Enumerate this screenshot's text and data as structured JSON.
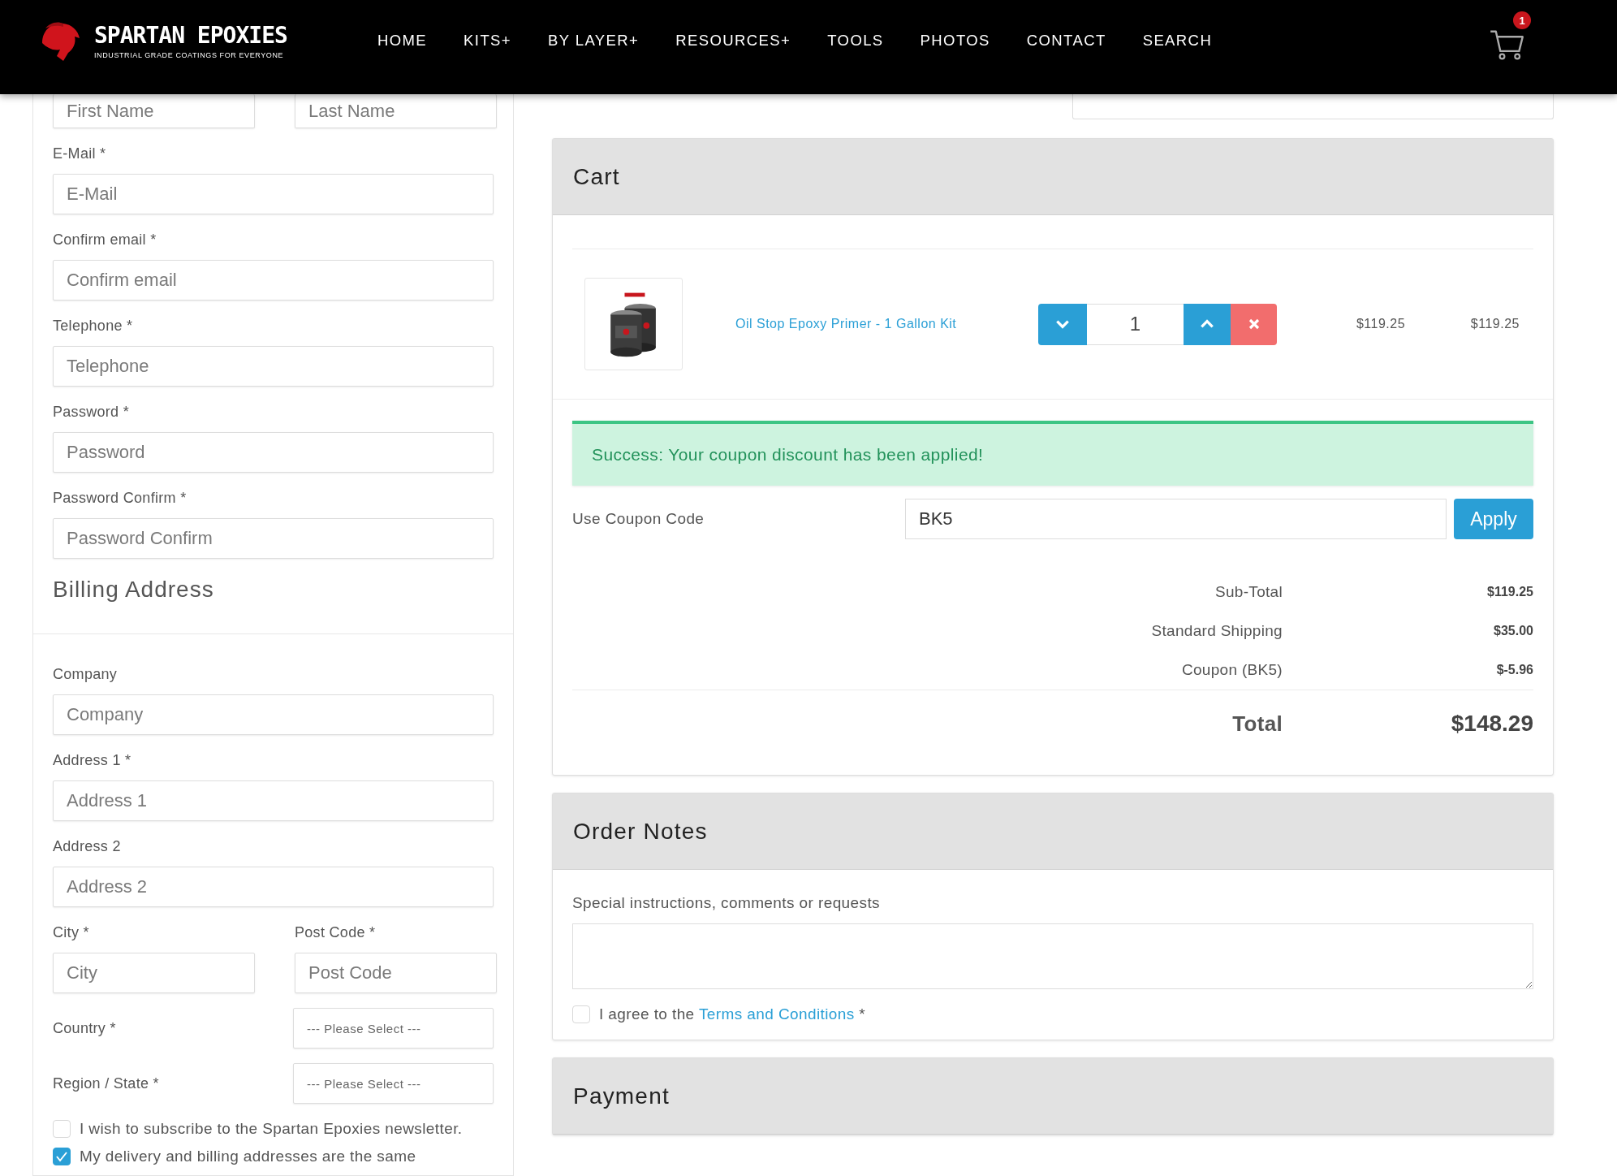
{
  "header": {
    "logo": {
      "name": "SPARTAN EPOXIES",
      "tagline": "INDUSTRIAL GRADE COATINGS FOR EVERYONE"
    },
    "nav": [
      {
        "label": "HOME"
      },
      {
        "label": "KITS+"
      },
      {
        "label": "BY LAYER+"
      },
      {
        "label": "RESOURCES+"
      },
      {
        "label": "TOOLS"
      },
      {
        "label": "PHOTOS"
      },
      {
        "label": "CONTACT"
      },
      {
        "label": "SEARCH"
      }
    ],
    "cart_badge": "1"
  },
  "account_form": {
    "rows": [
      {
        "kind": "pair",
        "fields": [
          {
            "placeholder": "First Name"
          },
          {
            "placeholder": "Last Name"
          }
        ]
      },
      {
        "kind": "input",
        "label": "E-Mail *",
        "placeholder": "E-Mail"
      },
      {
        "kind": "input",
        "label": "Confirm email *",
        "placeholder": "Confirm email"
      },
      {
        "kind": "input",
        "label": "Telephone *",
        "placeholder": "Telephone"
      },
      {
        "kind": "input",
        "label": "Password *",
        "placeholder": "Password"
      },
      {
        "kind": "input",
        "label": "Password Confirm *",
        "placeholder": "Password Confirm"
      }
    ]
  },
  "billing_address": {
    "title": "Billing Address",
    "rows": [
      {
        "kind": "input",
        "label": "Company",
        "placeholder": "Company"
      },
      {
        "kind": "input",
        "label": "Address 1 *",
        "placeholder": "Address 1"
      },
      {
        "kind": "input",
        "label": "Address 2",
        "placeholder": "Address 2"
      },
      {
        "kind": "pair",
        "fields": [
          {
            "label": "City *",
            "placeholder": "City"
          },
          {
            "label": "Post Code *",
            "placeholder": "Post Code"
          }
        ]
      },
      {
        "kind": "select",
        "label": "Country *",
        "value": "--- Please Select ---"
      },
      {
        "kind": "select",
        "label": "Region / State *",
        "value": "--- Please Select ---"
      }
    ],
    "checkboxes": [
      {
        "label": "I wish to subscribe to the Spartan Epoxies newsletter.",
        "checked": false
      },
      {
        "label": "My delivery and billing addresses are the same",
        "checked": true
      }
    ]
  },
  "cart": {
    "title": "Cart",
    "items": [
      {
        "kind": "picture",
        "name": "Oil Stop Epoxy Primer - 1 Gallon Kit",
        "quantity": "1",
        "unit_price": "$119.25",
        "total": "$119.25"
      }
    ],
    "alert": "Success: Your coupon discount has been applied!",
    "coupon": {
      "label": "Use Coupon Code",
      "value": "BK5",
      "button": "Apply"
    },
    "totals": [
      {
        "kind": "line",
        "label": "Sub-Total",
        "value": "$119.25"
      },
      {
        "kind": "line",
        "label": "Standard Shipping",
        "value": "$35.00"
      },
      {
        "kind": "line",
        "label": "Coupon (BK5)",
        "value": "$-5.96"
      },
      {
        "kind": "grand",
        "label": "Total",
        "value": "$148.29"
      }
    ]
  },
  "order_notes": {
    "title": "Order Notes",
    "label": "Special instructions, comments or requests",
    "agree": {
      "text": "I agree to the ",
      "link": "Terms and Conditions",
      "suffix": " *",
      "checked": false
    }
  },
  "payment": {
    "title": "Payment"
  }
}
